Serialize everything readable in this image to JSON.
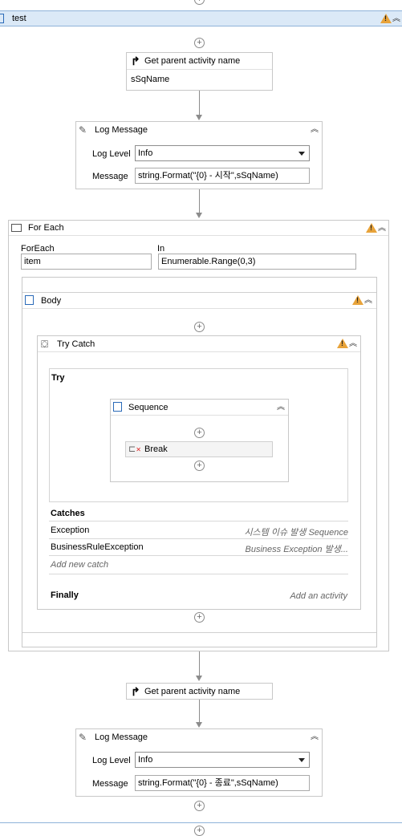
{
  "workflow": {
    "title": "test",
    "get_parent_1": {
      "title": "Get parent activity name",
      "value": "sSqName"
    },
    "log_message_1": {
      "title": "Log Message",
      "level_label": "Log Level",
      "level_value": "Info",
      "message_label": "Message",
      "message_value": "string.Format(\"{0} - 시작\",sSqName)"
    },
    "for_each": {
      "title": "For Each",
      "foreach_label": "ForEach",
      "foreach_value": "item",
      "in_label": "In",
      "in_value": "Enumerable.Range(0,3)",
      "body": {
        "title": "Body",
        "try_catch": {
          "title": "Try Catch",
          "try_label": "Try",
          "sequence": {
            "title": "Sequence",
            "break_label": "Break"
          },
          "catches_label": "Catches",
          "catches": [
            {
              "exception": "Exception",
              "handler": "시스템 이슈 발생 Sequence"
            },
            {
              "exception": "BusinessRuleException",
              "handler": "Business Exception 발생..."
            }
          ],
          "add_catch": "Add new catch",
          "finally_label": "Finally",
          "add_activity": "Add an activity"
        }
      }
    },
    "get_parent_2": {
      "title": "Get parent activity name"
    },
    "log_message_2": {
      "title": "Log Message",
      "level_label": "Log Level",
      "level_value": "Info",
      "message_label": "Message",
      "message_value": "string.Format(\"{0} - 종료\",sSqName)"
    }
  },
  "colors": {
    "header_bg": "#dbe9f7",
    "header_border": "#8fb3d9",
    "warning": "#e8a33a",
    "connector": "#8c8c8c"
  },
  "icons": [
    "add-icon",
    "collapse-icon",
    "warning-icon",
    "sequence-icon",
    "get-parent-icon",
    "log-message-icon",
    "foreach-icon",
    "trycatch-icon",
    "break-icon",
    "dropdown-caret-icon"
  ]
}
